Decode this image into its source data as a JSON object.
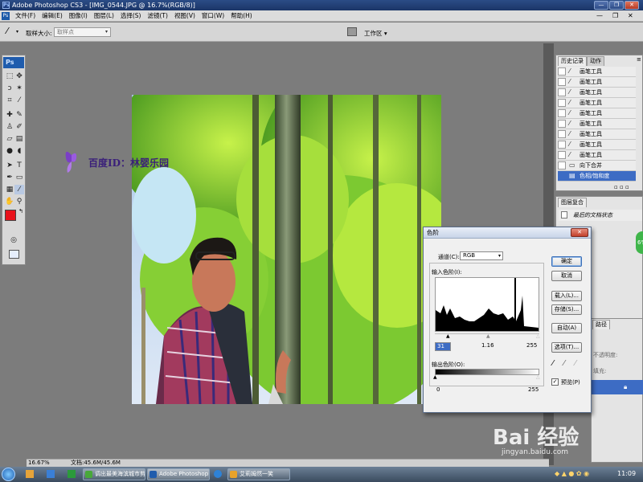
{
  "window": {
    "title": "Adobe Photoshop CS3 - [IMG_0544.JPG @ 16.7%(RGB/8)]",
    "buttons": [
      "—",
      "❐",
      "✕"
    ]
  },
  "menu": {
    "items": [
      "文件(F)",
      "编辑(E)",
      "图像(I)",
      "图层(L)",
      "选择(S)",
      "滤镜(T)",
      "视图(V)",
      "窗口(W)",
      "帮助(H)"
    ],
    "doc_buttons": [
      "—",
      "❐",
      "✕"
    ]
  },
  "options": {
    "sample_size_label": "取样大小:",
    "sample_size_value": "取样点",
    "workspace_label": "工作区 ▾"
  },
  "watermark": {
    "text": "百度ID：林婴乐园"
  },
  "panels": {
    "history": {
      "tabs": [
        "历史记录",
        "动作"
      ],
      "rows": [
        "画笔工具",
        "画笔工具",
        "画笔工具",
        "画笔工具",
        "画笔工具",
        "画笔工具",
        "画笔工具",
        "画笔工具",
        "画笔工具",
        "向下合并",
        "色相/饱和度"
      ]
    },
    "info": {
      "tab": "图层复合",
      "row": "最后的文档状态"
    },
    "layers": {
      "tab": "路径",
      "opacity_label": "不透明度:",
      "fill_label": "填充:"
    }
  },
  "levels": {
    "title": "色阶",
    "channel_label": "通道(C):",
    "channel_value": "RGB",
    "input_label": "输入色阶(I):",
    "input_values": [
      "31",
      "1.16",
      "255"
    ],
    "output_label": "输出色阶(O):",
    "output_values": [
      "0",
      "255"
    ],
    "buttons": [
      "确定",
      "取消",
      "载入(L)...",
      "存储(S)...",
      "自动(A)",
      "选项(T)..."
    ],
    "preview_label": "预览(P)",
    "preview_checked": true
  },
  "status": {
    "zoom": "16.67%",
    "doc": "文档:45.6M/45.6M"
  },
  "taskbar": {
    "tasks": [
      "调出最美海滨城市剪...",
      "Adobe Photoshop ...",
      "艾莉姆然一笑"
    ],
    "clock": "11:09"
  },
  "brand": {
    "logo": "Bai 经验",
    "url": "jingyan.baidu.com"
  },
  "colors": {
    "foreground": "#e8111b",
    "background": "#ffffff",
    "titlebar": "#2b4c86",
    "selection": "#3d6cc4"
  }
}
